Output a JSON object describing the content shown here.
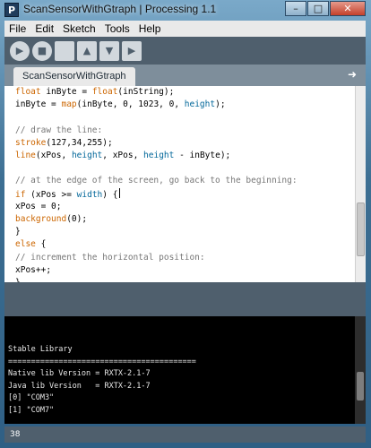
{
  "window": {
    "title": "ScanSensorWithGtraph | Processing 1.1",
    "app_icon_letter": "P",
    "buttons": [
      "–",
      "□",
      "✕"
    ]
  },
  "menubar": {
    "items": [
      "File",
      "Edit",
      "Sketch",
      "Tools",
      "Help"
    ]
  },
  "toolbar": {
    "buttons": [
      {
        "name": "run-button",
        "icon": "play-icon",
        "glyph": "▶"
      },
      {
        "name": "stop-button",
        "icon": "stop-icon",
        "glyph": "■"
      },
      {
        "name": "new-button",
        "icon": "new-file-icon",
        "glyph": ""
      },
      {
        "name": "open-button",
        "icon": "open-icon",
        "glyph": "▲"
      },
      {
        "name": "save-button",
        "icon": "save-icon",
        "glyph": "▼"
      },
      {
        "name": "export-button",
        "icon": "export-icon",
        "glyph": "▶"
      }
    ]
  },
  "tabs": {
    "active": "ScanSensorWithGtraph",
    "arrow": "➜"
  },
  "editor": {
    "lines": [
      {
        "parts": [
          {
            "t": "float",
            "c": "kw"
          },
          {
            "t": " inByte = ",
            "c": ""
          },
          {
            "t": "float",
            "c": "kw"
          },
          {
            "t": "(inString);",
            "c": ""
          }
        ]
      },
      {
        "parts": [
          {
            "t": "inByte = ",
            "c": ""
          },
          {
            "t": "map",
            "c": "kw"
          },
          {
            "t": "(inByte, 0, 1023, 0, ",
            "c": ""
          },
          {
            "t": "height",
            "c": "fn"
          },
          {
            "t": ");",
            "c": ""
          }
        ]
      },
      {
        "parts": []
      },
      {
        "parts": [
          {
            "t": "// draw the line:",
            "c": "cm"
          }
        ]
      },
      {
        "parts": [
          {
            "t": "stroke",
            "c": "kw"
          },
          {
            "t": "(127,34,255);",
            "c": ""
          }
        ]
      },
      {
        "parts": [
          {
            "t": "line",
            "c": "kw"
          },
          {
            "t": "(xPos, ",
            "c": ""
          },
          {
            "t": "height",
            "c": "fn"
          },
          {
            "t": ", xPos, ",
            "c": ""
          },
          {
            "t": "height",
            "c": "fn"
          },
          {
            "t": " - inByte);",
            "c": ""
          }
        ]
      },
      {
        "parts": []
      },
      {
        "parts": [
          {
            "t": "// at the edge of the screen, go back to the beginning:",
            "c": "cm"
          }
        ]
      },
      {
        "parts": [
          {
            "t": "if",
            "c": "kw"
          },
          {
            "t": " (xPos >= ",
            "c": ""
          },
          {
            "t": "width",
            "c": "fn"
          },
          {
            "t": ") {",
            "c": ""
          }
        ]
      },
      {
        "parts": [
          {
            "t": "xPos = 0;",
            "c": ""
          }
        ]
      },
      {
        "parts": [
          {
            "t": "background",
            "c": "kw"
          },
          {
            "t": "(0);",
            "c": ""
          }
        ]
      },
      {
        "parts": [
          {
            "t": "}",
            "c": ""
          }
        ]
      },
      {
        "parts": [
          {
            "t": "else",
            "c": "kw"
          },
          {
            "t": " {",
            "c": ""
          }
        ]
      },
      {
        "parts": [
          {
            "t": "// increment the horizontal position:",
            "c": "cm"
          }
        ]
      },
      {
        "parts": [
          {
            "t": "xPos++;",
            "c": ""
          }
        ]
      },
      {
        "parts": [
          {
            "t": "}",
            "c": ""
          }
        ]
      }
    ]
  },
  "console": {
    "lines": [
      "",
      "",
      "Stable Library",
      "=========================================",
      "Native lib Version = RXTX-2.1-7",
      "Java lib Version   = RXTX-2.1-7",
      "[0] \"COM3\"",
      "[1] \"COM7\""
    ]
  },
  "status": {
    "line_number": "38"
  },
  "colors": {
    "toolbar_bg": "#4f5f6d",
    "keyword": "#cc6600",
    "builtin_var": "#006699",
    "comment": "#777777"
  }
}
